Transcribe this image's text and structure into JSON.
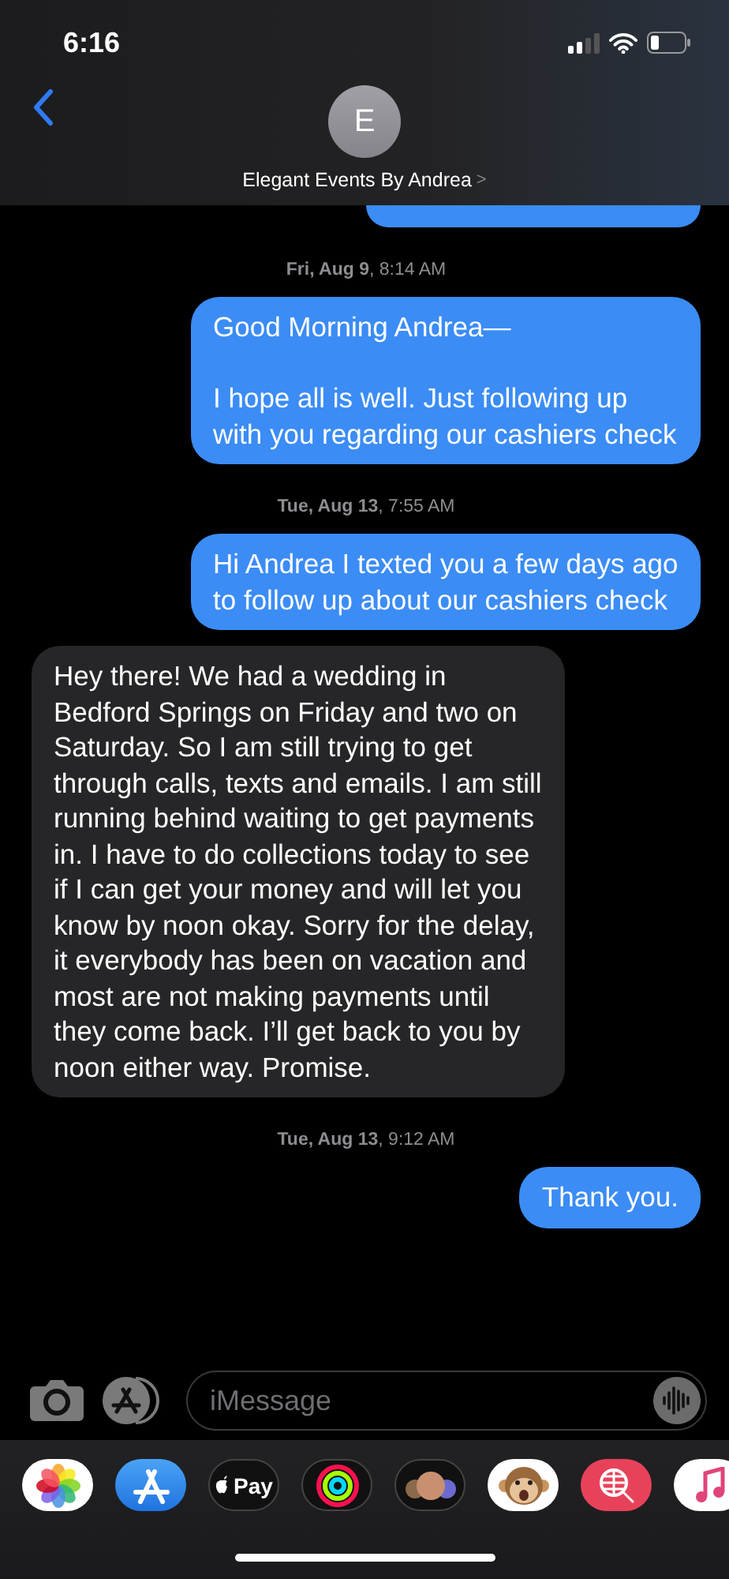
{
  "status_bar": {
    "time": "6:16"
  },
  "header": {
    "avatar_initial": "E",
    "contact_name": "Elegant Events By Andrea",
    "chevron": ">"
  },
  "messages": [
    {
      "kind": "partial",
      "outgoing": true
    },
    {
      "kind": "timestamp",
      "text": "**Fri, Aug 9**, 8:14 AM"
    },
    {
      "kind": "message",
      "outgoing": true,
      "text": "Good Morning Andrea—\n\nI hope all is well. Just following up with you regarding our cashiers check"
    },
    {
      "kind": "timestamp",
      "text": "**Tue, Aug 13**, 7:55 AM"
    },
    {
      "kind": "message",
      "outgoing": true,
      "text": "Hi Andrea I texted you a few days ago to follow up about our cashiers check"
    },
    {
      "kind": "message",
      "outgoing": false,
      "text": "Hey there! We had a wedding in Bedford Springs on Friday and two on Saturday. So I am still trying to get through calls, texts and emails. I am still running behind waiting to get payments in.  I have to do collections today to see if I can get your money and will let you know by noon okay. Sorry for the delay,  it everybody has been on vacation and most are not making payments until they come back. I’ll get back to you by noon either way. Promise."
    },
    {
      "kind": "timestamp",
      "text": "**Tue, Aug 13**, 9:12 AM"
    },
    {
      "kind": "message",
      "outgoing": true,
      "text": "Thank you."
    }
  ],
  "compose": {
    "placeholder": "iMessage"
  },
  "app_drawer": [
    {
      "kind": "photos"
    },
    {
      "kind": "app-store"
    },
    {
      "kind": "apple-pay",
      "label": "Pay"
    },
    {
      "kind": "activity"
    },
    {
      "kind": "memoji"
    },
    {
      "kind": "animoji"
    },
    {
      "kind": "web-search"
    },
    {
      "kind": "music"
    }
  ]
}
